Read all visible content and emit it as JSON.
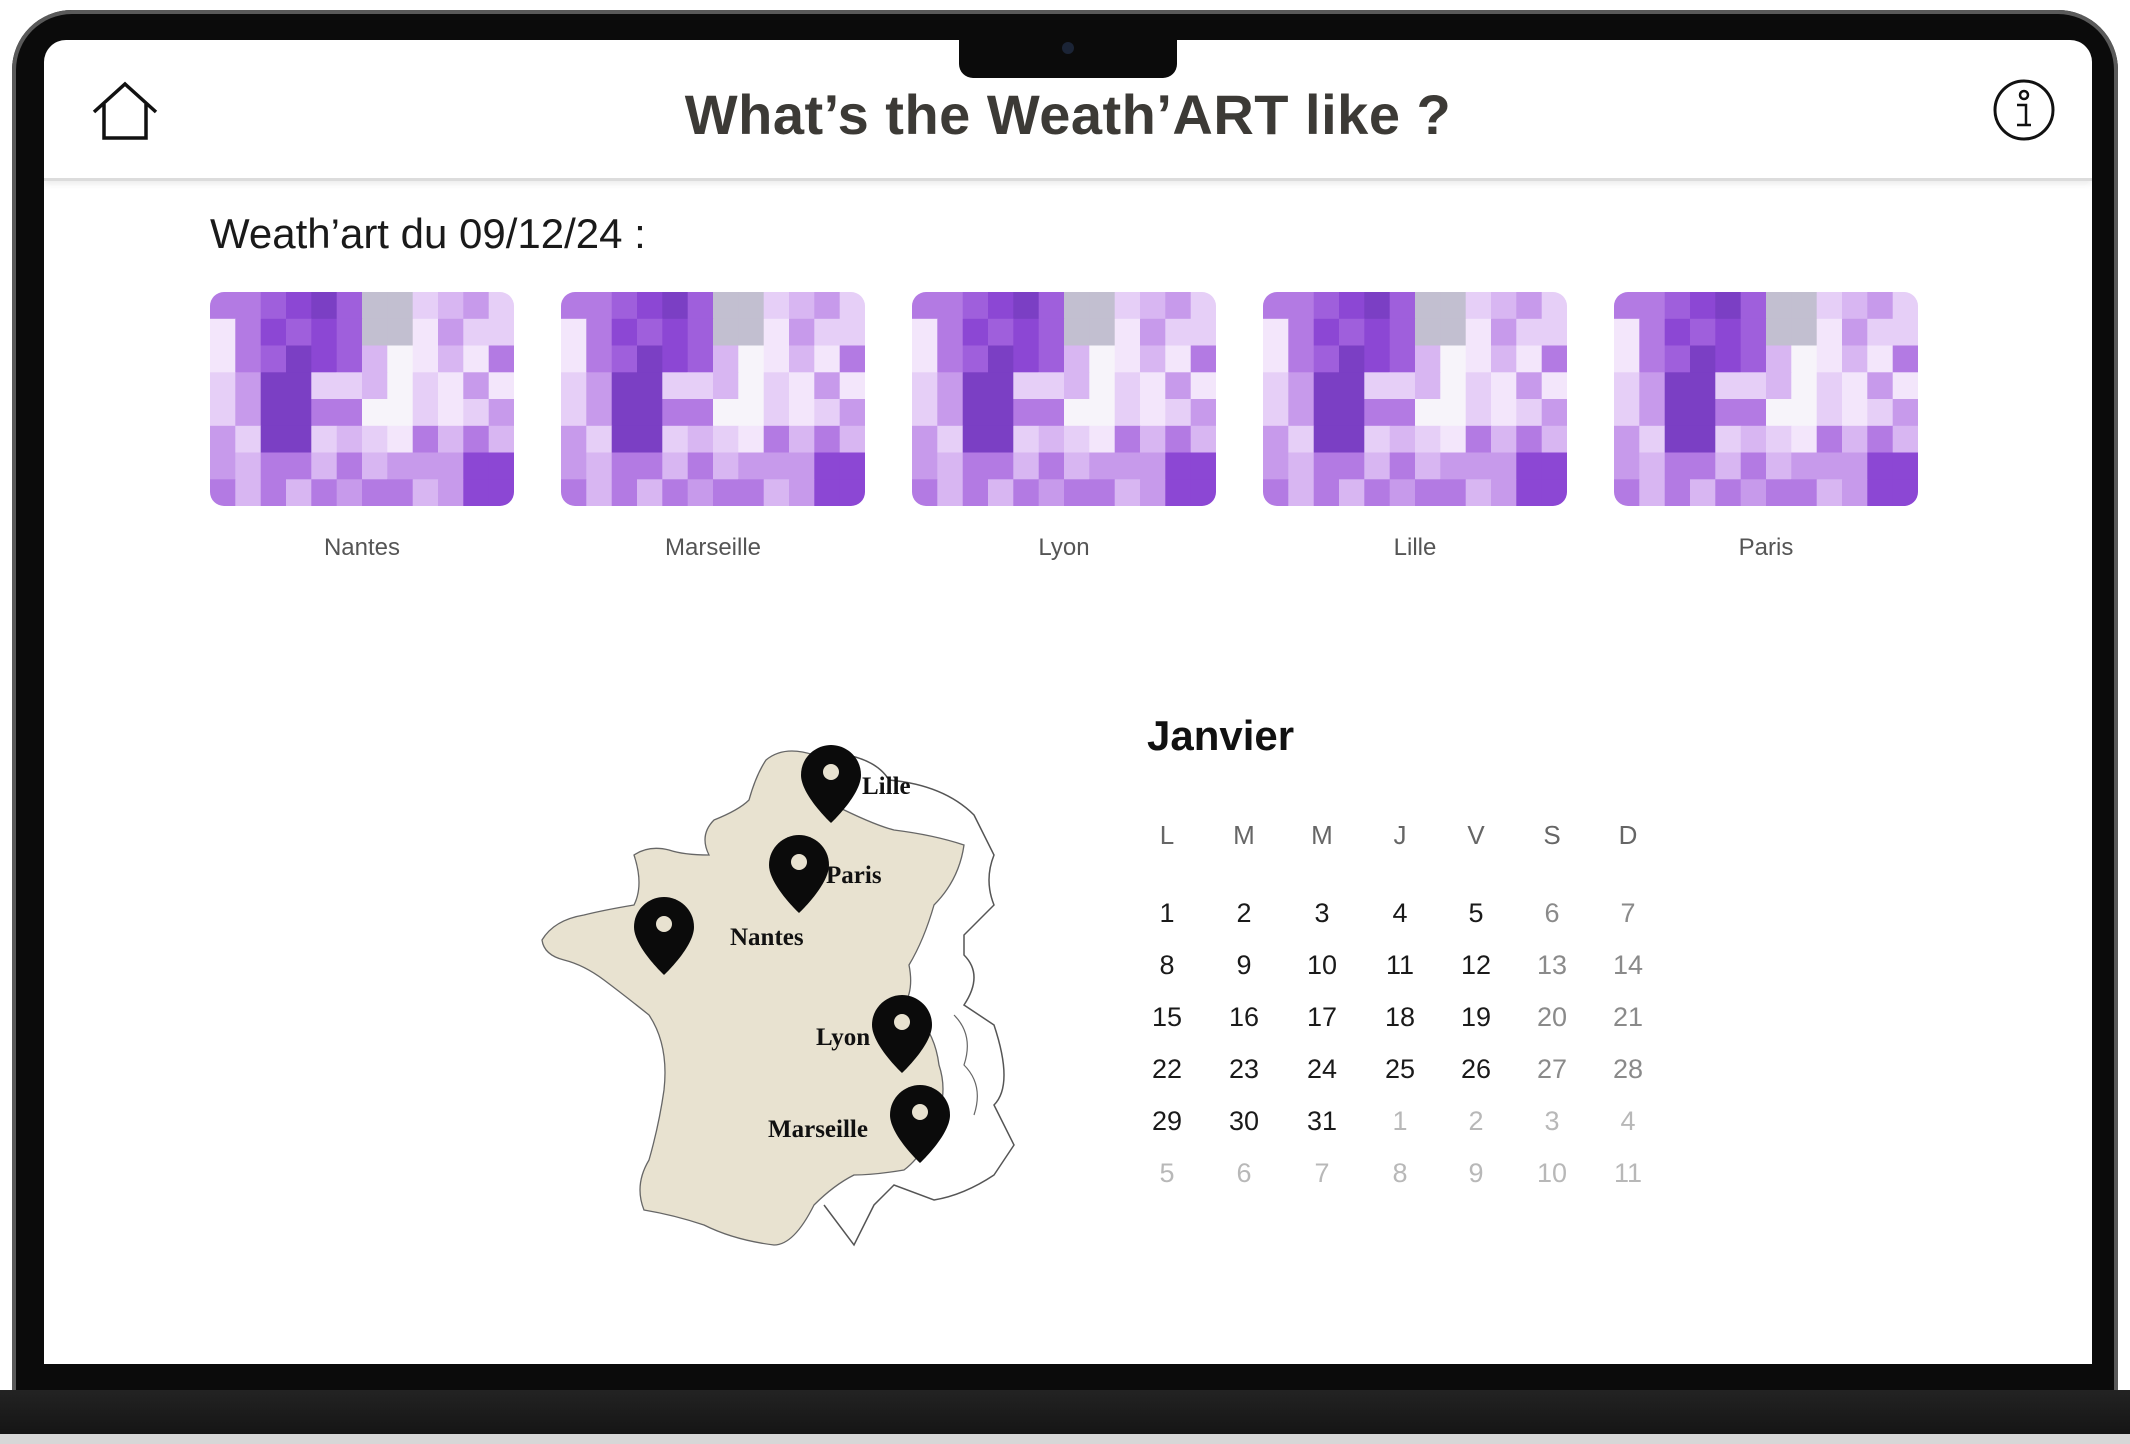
{
  "header": {
    "title": "What’s the Weath’ART like ?"
  },
  "weathart": {
    "heading": "Weath’art du 09/12/24 :",
    "cities": [
      {
        "label": "Nantes"
      },
      {
        "label": "Marseille"
      },
      {
        "label": "Lyon"
      },
      {
        "label": "Lille"
      },
      {
        "label": "Paris"
      }
    ],
    "palette": [
      "#f3e6fb",
      "#e6cff7",
      "#d8b6f2",
      "#c79aeb",
      "#b37ae3",
      "#9f5fdc",
      "#8c47d4",
      "#7b3fc4",
      "#c2bfd0",
      "#f7f4fa"
    ]
  },
  "map": {
    "labels": {
      "lille": "Lille",
      "paris": "Paris",
      "nantes": "Nantes",
      "lyon": "Lyon",
      "marseille": "Marseille"
    },
    "fill_color": "#e8e2d0"
  },
  "calendar": {
    "month": "Janvier",
    "weekdays": [
      "L",
      "M",
      "M",
      "J",
      "V",
      "S",
      "D"
    ],
    "weeks": [
      [
        "1",
        "2",
        "3",
        "4",
        "5",
        "6",
        "7"
      ],
      [
        "8",
        "9",
        "10",
        "11",
        "12",
        "13",
        "14"
      ],
      [
        "15",
        "16",
        "17",
        "18",
        "19",
        "20",
        "21"
      ],
      [
        "22",
        "23",
        "24",
        "25",
        "26",
        "27",
        "28"
      ],
      [
        "29",
        "30",
        "31",
        "1",
        "2",
        "3",
        "4"
      ],
      [
        "5",
        "6",
        "7",
        "8",
        "9",
        "10",
        "11"
      ]
    ]
  }
}
